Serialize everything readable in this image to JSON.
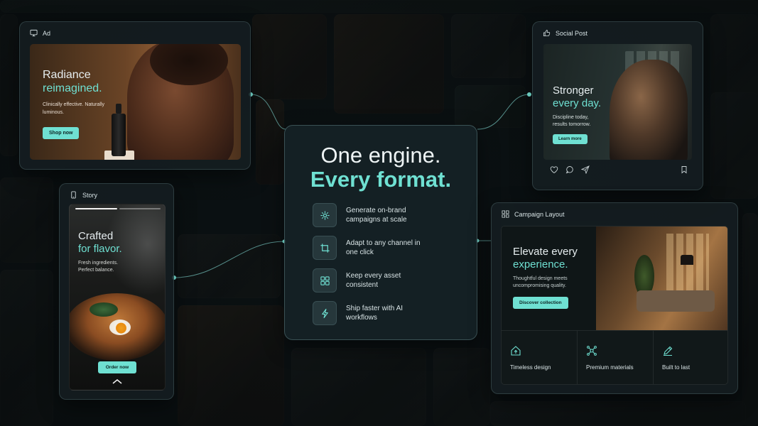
{
  "center": {
    "title_line1": "One engine.",
    "title_line2": "Every format.",
    "features": [
      {
        "icon": "sparkle-icon",
        "text": "Generate on-brand campaigns at scale"
      },
      {
        "icon": "crop-icon",
        "text": "Adapt to any channel in one click"
      },
      {
        "icon": "grid-icon",
        "text": "Keep every asset consistent"
      },
      {
        "icon": "lightning-icon",
        "text": "Ship faster with AI workflows"
      }
    ]
  },
  "ad": {
    "label": "Ad",
    "headline_1": "Radiance",
    "headline_2": "reimagined.",
    "sub": "Clinically effective. Naturally luminous.",
    "cta": "Shop now"
  },
  "social": {
    "label": "Social Post",
    "headline_1": "Stronger",
    "headline_2": "every day.",
    "sub": "Discipline today, results tomorrow.",
    "cta": "Learn more"
  },
  "story": {
    "label": "Story",
    "headline_1": "Crafted",
    "headline_2": "for flavor.",
    "sub_1": "Fresh ingredients.",
    "sub_2": "Perfect balance.",
    "cta": "Order now"
  },
  "campaign": {
    "label": "Campaign Layout",
    "headline_1": "Elevate every",
    "headline_2": "experience.",
    "sub": "Thoughtful design meets uncompromising quality.",
    "cta": "Discover collection",
    "pillars": [
      {
        "icon": "home-upgrade-icon",
        "label": "Timeless design"
      },
      {
        "icon": "molecule-icon",
        "label": "Premium materials"
      },
      {
        "icon": "pencil-icon",
        "label": "Built to last"
      }
    ]
  },
  "colors": {
    "accent": "#6fe0d2",
    "background": "#0b1113",
    "panel": "#141e21"
  }
}
